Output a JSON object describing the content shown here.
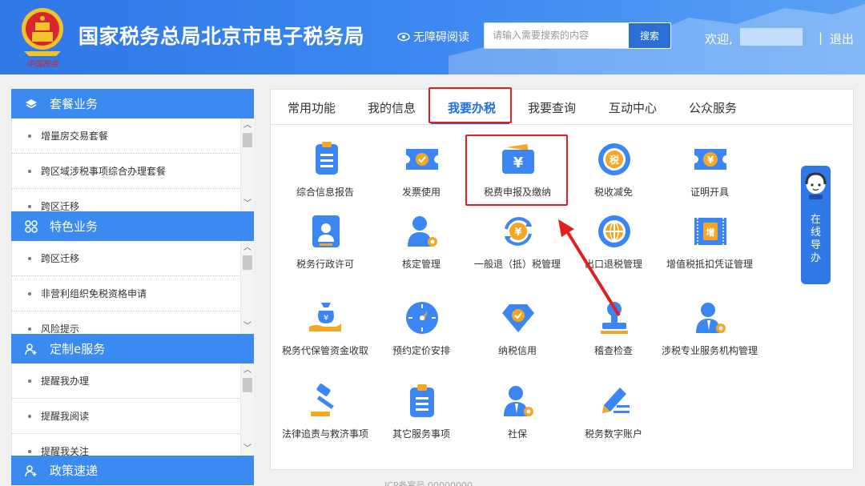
{
  "header": {
    "title": "国家税务总局北京市电子税务局",
    "emblem_caption": "中国税务",
    "accessibility": "无障碍阅读",
    "search_placeholder": "请输入需要搜索的内容",
    "search_button": "搜索",
    "welcome": "欢迎,",
    "separator": "|",
    "logout": "退出"
  },
  "sidebar": {
    "sections": [
      {
        "title": "套餐业务",
        "icon": "layers-icon",
        "items": [
          "增量房交易套餐",
          "跨区域涉税事项综合办理套餐",
          "跨区迁移"
        ]
      },
      {
        "title": "特色业务",
        "icon": "grid-icon",
        "items": [
          "跨区迁移",
          "非营利组织免税资格申请",
          "风险提示"
        ]
      },
      {
        "title": "定制e服务",
        "icon": "user-plus-icon",
        "items": [
          "提醒我办理",
          "提醒我阅读",
          "提醒我关注"
        ]
      },
      {
        "title": "政策速递",
        "icon": "user-plus-icon",
        "items": []
      }
    ]
  },
  "tabs": [
    "常用功能",
    "我的信息",
    "我要办税",
    "我要查询",
    "互动中心",
    "公众服务"
  ],
  "active_tab": "我要办税",
  "functions": [
    {
      "label": "综合信息报告",
      "icon": "report-icon"
    },
    {
      "label": "发票使用",
      "icon": "invoice-ticket-icon"
    },
    {
      "label": "税费申报及缴纳",
      "icon": "yuan-wallet-icon"
    },
    {
      "label": "税收减免",
      "icon": "tax-relief-icon"
    },
    {
      "label": "证明开具",
      "icon": "certificate-ticket-icon"
    },
    {
      "label": "税务行政许可",
      "icon": "id-card-icon"
    },
    {
      "label": "核定管理",
      "icon": "user-gear-icon"
    },
    {
      "label": "一般退（抵）税管理",
      "icon": "yuan-refresh-icon"
    },
    {
      "label": "出口退税管理",
      "icon": "globe-icon"
    },
    {
      "label": "增值税抵扣凭证管理",
      "icon": "vat-ticket-icon"
    },
    {
      "label": "税务代保管资金收取",
      "icon": "money-bag-hand-icon"
    },
    {
      "label": "预约定价安排",
      "icon": "compass-icon"
    },
    {
      "label": "纳税信用",
      "icon": "diamond-check-icon"
    },
    {
      "label": "稽查检查",
      "icon": "stamp-icon"
    },
    {
      "label": "涉税专业服务机构管理",
      "icon": "agent-gear-icon"
    },
    {
      "label": "法律追责与救济事项",
      "icon": "gavel-icon"
    },
    {
      "label": "其它服务事项",
      "icon": "clipboard-icon"
    },
    {
      "label": "社保",
      "icon": "person-gear-icon"
    },
    {
      "label": "税务数字账户",
      "icon": "pen-lines-icon"
    }
  ],
  "online_help": "在线导办",
  "footer_faint": "ICP备案号 00000000"
}
